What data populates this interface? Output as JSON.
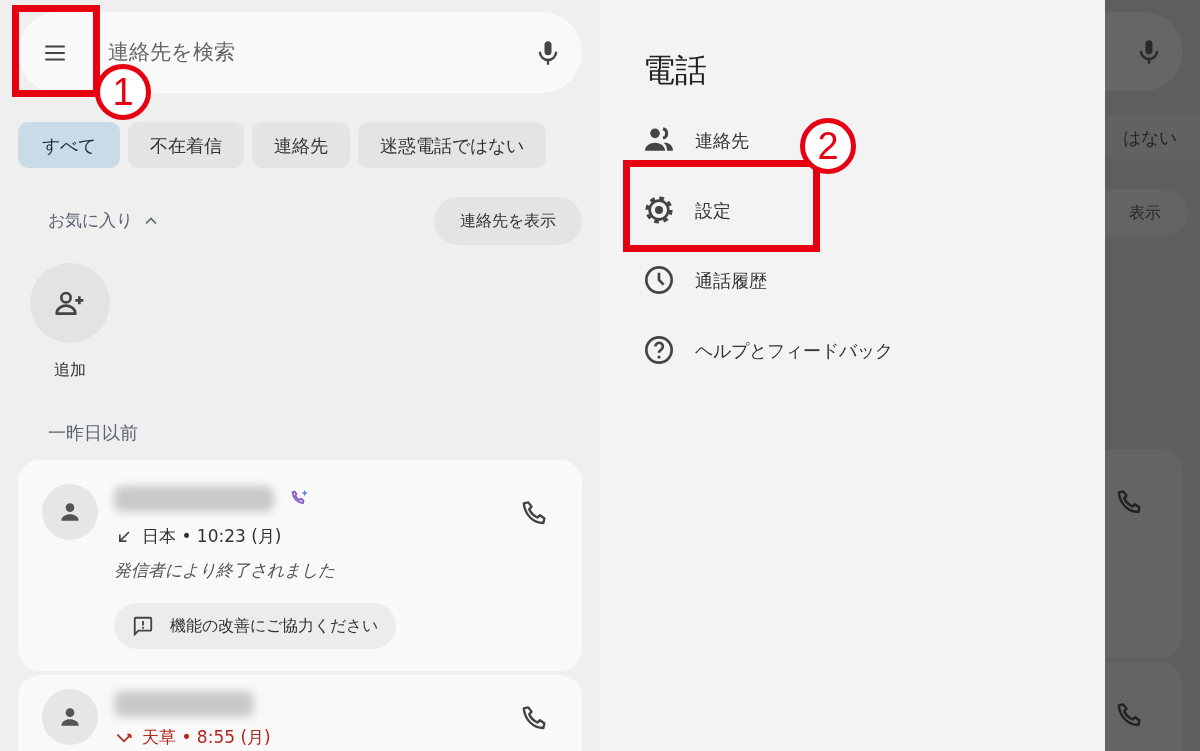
{
  "search": {
    "placeholder": "連絡先を検索"
  },
  "filters": [
    {
      "label": "すべて",
      "selected": true
    },
    {
      "label": "不在着信",
      "selected": false
    },
    {
      "label": "連絡先",
      "selected": false
    },
    {
      "label": "迷惑電話ではない",
      "selected": false
    }
  ],
  "favorites": {
    "title": "お気に入り",
    "expanded": true,
    "show_contacts_button": "連絡先を表示",
    "add_label": "追加"
  },
  "section_title": "一昨日以前",
  "calls": [
    {
      "kind": "incoming",
      "ai_badge": true,
      "detail": "日本 • 10:23 (月)",
      "note": "発信者により終了されました",
      "feedback_chip": "機能の改善にご協力ください"
    },
    {
      "kind": "missed",
      "ai_badge": false,
      "detail": "天草 • 8:55 (月)"
    }
  ],
  "drawer": {
    "title": "電話",
    "items": [
      {
        "kind": "contacts",
        "label": "連絡先"
      },
      {
        "kind": "settings",
        "label": "設定"
      },
      {
        "kind": "history",
        "label": "通話履歴"
      },
      {
        "kind": "help",
        "label": "ヘルプとフィードバック"
      }
    ]
  },
  "background_peek": {
    "filter_fragment": "はない",
    "button_fragment": "表示"
  },
  "annotations": [
    {
      "label": "1"
    },
    {
      "label": "2"
    }
  ]
}
